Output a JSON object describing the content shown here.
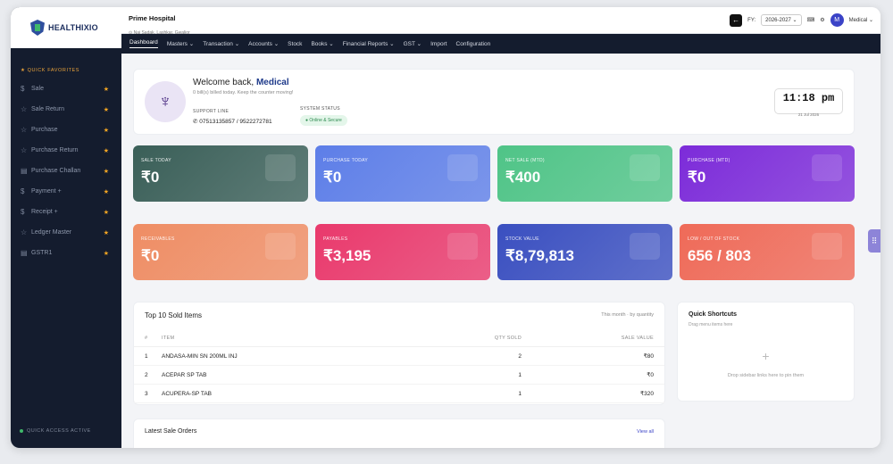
{
  "brand": {
    "name": "HEALTHIXIO"
  },
  "sidebar": {
    "section_label": "★ QUICK FAVORITES",
    "items": [
      {
        "icon": "$",
        "label": "Sale"
      },
      {
        "icon": "☆",
        "label": "Sale Return"
      },
      {
        "icon": "☆",
        "label": "Purchase"
      },
      {
        "icon": "☆",
        "label": "Purchase Return"
      },
      {
        "icon": "▤",
        "label": "Purchase Challan"
      },
      {
        "icon": "$",
        "label": "Payment +"
      },
      {
        "icon": "$",
        "label": "Receipt +"
      },
      {
        "icon": "☆",
        "label": "Ledger Master"
      },
      {
        "icon": "▤",
        "label": "GSTR1"
      }
    ],
    "star": "★",
    "footer": "QUICK ACCESS ACTIVE"
  },
  "header": {
    "hospital_name": "Prime Hospital",
    "hospital_address": "⊙ Nai Sadak, Lashkar, Gwalior",
    "back": "←",
    "fy_label": "FY:",
    "fy_value": "2026-2027 ⌄",
    "lang": "⌨",
    "settings": "⚙",
    "avatar": "M",
    "user": "Medical ⌄"
  },
  "nav": [
    "Dashboard",
    "Masters ⌄",
    "Transaction ⌄",
    "Accounts ⌄",
    "Stock",
    "Books ⌄",
    "Financial Reports ⌄",
    "GST ⌄",
    "Import",
    "Configuration"
  ],
  "welcome": {
    "greeting": "Welcome back, ",
    "user": "Medical",
    "sub": "0 bill(s) billed today. Keep the counter moving!",
    "support_label": "SUPPORT LINE",
    "support_phone": "✆ 07513135857 / 9522272781",
    "status_label": "SYSTEM STATUS",
    "status_value": "● Online & Secure",
    "logo_glyph": "♆",
    "time": "11:18 pm",
    "date": "21 Jul 2026"
  },
  "cards": [
    {
      "label": "SALE TODAY",
      "value": "₹0",
      "color": "#3a5f58"
    },
    {
      "label": "PURCHASE TODAY",
      "value": "₹0",
      "color": "#5d7ee8"
    },
    {
      "label": "NET SALE (MTD)",
      "value": "₹400",
      "color": "#4fc487"
    },
    {
      "label": "PURCHASE (MTD)",
      "value": "₹0",
      "color": "#7c2bd9"
    },
    {
      "label": "RECEIVABLES",
      "value": "₹0",
      "color": "#ef8d64"
    },
    {
      "label": "PAYABLES",
      "value": "₹3,195",
      "color": "#e9396c"
    },
    {
      "label": "STOCK VALUE",
      "value": "₹8,79,813",
      "color": "#3a4fc0"
    },
    {
      "label": "LOW / OUT OF STOCK",
      "value": "656 / 803",
      "color": "#ef6a58"
    }
  ],
  "top_items": {
    "title": "Top 10 Sold Items",
    "note": "This month · by quantity",
    "columns": [
      "#",
      "ITEM",
      "QTY SOLD",
      "SALE VALUE"
    ],
    "rows": [
      {
        "n": "1",
        "item": "ANDASA-MIN SN 200ML INJ",
        "qty": "2",
        "value": "₹80"
      },
      {
        "n": "2",
        "item": "ACEPAR SP TAB",
        "qty": "1",
        "value": "₹0"
      },
      {
        "n": "3",
        "item": "ACUPERA-SP TAB",
        "qty": "1",
        "value": "₹320"
      }
    ]
  },
  "shortcuts": {
    "title": "Quick Shortcuts",
    "sub": "Drag menu items here",
    "plus": "+",
    "drop": "Drop sidebar links here to pin them"
  },
  "orders": {
    "title": "Latest Sale Orders",
    "link": "View all"
  },
  "grid_glyph": "⠿"
}
